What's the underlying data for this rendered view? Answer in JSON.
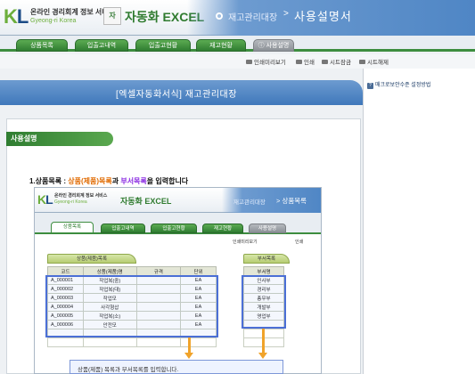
{
  "header": {
    "logo_mark_k": "K",
    "logo_mark_l": "L",
    "logo_line1": "온라인 경리회계 정보 서비스",
    "logo_line2": "Gyeong-ri Korea",
    "brand_badge": "자",
    "brand": "자동화 EXCEL",
    "breadcrumb_parent": "재고관리대장",
    "breadcrumb_sep": ">",
    "breadcrumb_current": "사용설명서"
  },
  "nav_tabs": [
    {
      "label": "상품목록",
      "active": false
    },
    {
      "label": "입출고내역",
      "active": false
    },
    {
      "label": "입출고현황",
      "active": false
    },
    {
      "label": "재고현황",
      "active": false
    },
    {
      "label": "사용설명",
      "active": true
    }
  ],
  "toolbar": {
    "preview": "인쇄미리보기",
    "print": "인쇄",
    "sheet_lock": "시트잠금",
    "sheet_unlock": "시트해제"
  },
  "banner": {
    "title": "[엑셀자동화서식] 재고관리대장"
  },
  "sidebar": {
    "help_link": "매크로보안수준 설정방법"
  },
  "section": {
    "title": "사용설명"
  },
  "step": {
    "number": "1.",
    "name": "상품목록 : ",
    "part_a": "상품(제품)목록",
    "and": "과 ",
    "part_b": "부서목록",
    "rest": "을 입력합니다"
  },
  "embedded": {
    "logo_line1": "온라인 경리회계 정보 서비스",
    "logo_line2": "Gyeong-ri Korea",
    "brand": "자동화 EXCEL",
    "crumb_parent": "재고관리대장",
    "crumb_current": "> 상품목록",
    "tabs": [
      {
        "label": "상품목록",
        "active": true
      },
      {
        "label": "입출고내역",
        "active": false
      },
      {
        "label": "입출고현황",
        "active": false
      },
      {
        "label": "재고현황",
        "active": false
      },
      {
        "label": "사용설명",
        "active": false
      }
    ],
    "toolbar_preview": "인쇄미리보기",
    "toolbar_print": "인쇄",
    "product_table_label": "상품(제품)목록",
    "product_columns": [
      "코드",
      "상품(제품)명",
      "규격",
      "단위"
    ],
    "product_rows": [
      [
        "A_000001",
        "작업복(중)",
        "",
        "EA"
      ],
      [
        "A_000002",
        "작업복(대)",
        "",
        "EA"
      ],
      [
        "A_000003",
        "작업모",
        "",
        "EA"
      ],
      [
        "A_000004",
        "사각형삽",
        "",
        "EA"
      ],
      [
        "A_000005",
        "작업복(소)",
        "",
        "EA"
      ],
      [
        "A_000006",
        "안전모",
        "",
        "EA"
      ]
    ],
    "dept_table_label": "부서목록",
    "dept_column": "부서명",
    "dept_rows": [
      "인사부",
      "경리부",
      "총무부",
      "개발부",
      "영업부"
    ],
    "tip": "상품(제품) 목록과 부서목록를 입력합니다."
  },
  "colors": {
    "brand_green": "#2f7d31",
    "header_blue": "#4f86c5",
    "highlight_blue": "#4b6fd6",
    "arrow_orange": "#f0a32b"
  }
}
